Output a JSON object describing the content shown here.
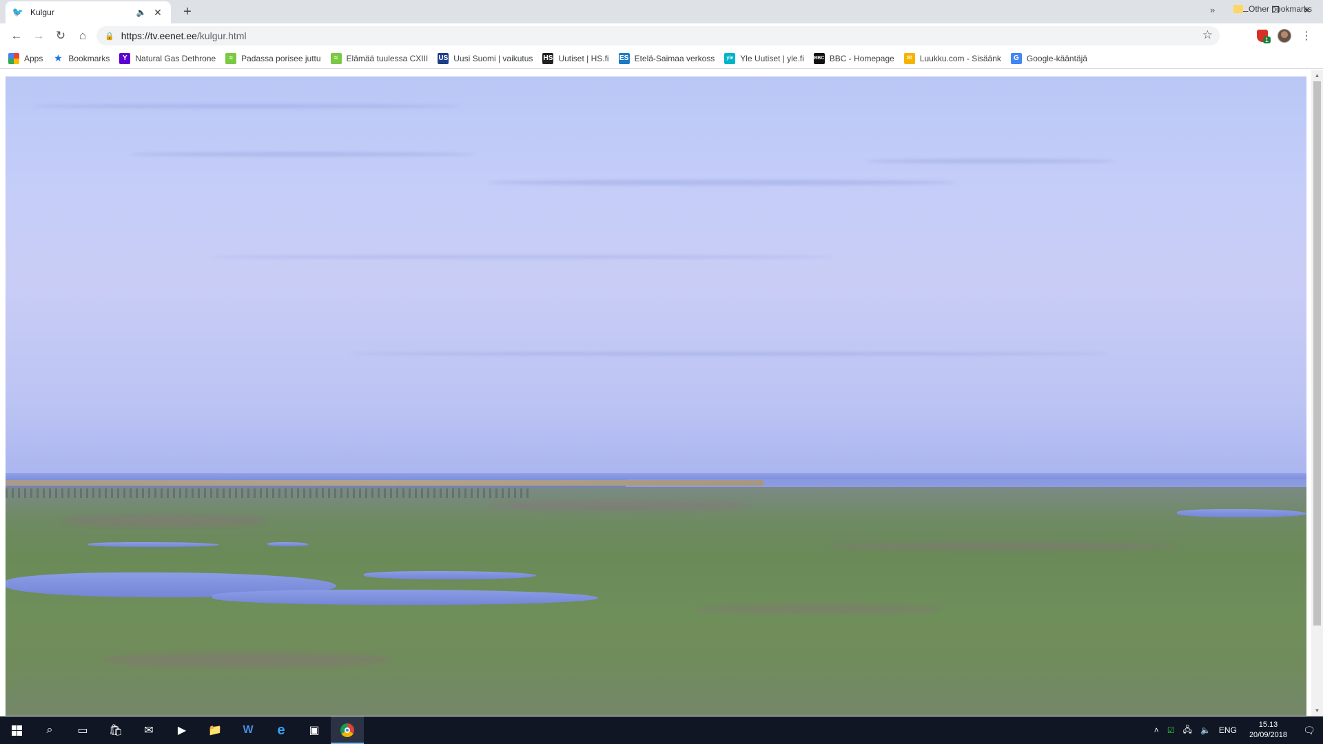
{
  "browser": {
    "tab": {
      "title": "Kulgur",
      "favicon": "bird-icon"
    },
    "url_domain": "https://tv.eenet.ee",
    "url_path": "/kulgur.html",
    "extension_badge": "1"
  },
  "bookmarks": [
    {
      "label": "Apps",
      "icon": "apps-grid-icon",
      "color": "#e8453c"
    },
    {
      "label": "Bookmarks",
      "icon": "star-icon",
      "color": "#1a73e8"
    },
    {
      "label": "Natural Gas Dethrone",
      "icon": "Y",
      "color": "#5f01d1"
    },
    {
      "label": "Padassa porisee juttu",
      "icon": "≈",
      "color": "#7ac943"
    },
    {
      "label": "Elämää tuulessa CXIII",
      "icon": "≈",
      "color": "#7ac943"
    },
    {
      "label": "Uusi Suomi | vaikutus",
      "icon": "US",
      "color": "#1d3f8a"
    },
    {
      "label": "Uutiset | HS.fi",
      "icon": "HS",
      "color": "#222222"
    },
    {
      "label": "Etelä-Saimaa verkoss",
      "icon": "ES",
      "color": "#1f7ac2"
    },
    {
      "label": "Yle Uutiset | yle.fi",
      "icon": "yle",
      "color": "#00b4c8"
    },
    {
      "label": "BBC - Homepage",
      "icon": "BBC",
      "color": "#111111"
    },
    {
      "label": "Luukku.com - Sisäänk",
      "icon": "✉",
      "color": "#f5b400"
    },
    {
      "label": "Google-kääntäjä",
      "icon": "G",
      "color": "#4285f4"
    }
  ],
  "bookmarks_more": "»",
  "other_bookmarks": "Other bookmarks",
  "taskbar": {
    "lang": "ENG",
    "time": "15.13",
    "date": "20/09/2018"
  },
  "colors": {
    "sky": "#c4cdf8",
    "marsh": "#6e8f5a",
    "taskbar": "#101624"
  }
}
